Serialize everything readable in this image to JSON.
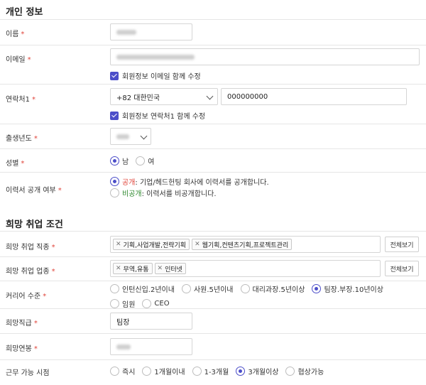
{
  "personal": {
    "title": "개인 정보",
    "name_label": "이름",
    "email_label": "이메일",
    "email_sync_label": "회원정보 이메일 함께 수정",
    "phone_label": "연락처1",
    "country_code": "+82 대한민국",
    "phone_number": "000000000",
    "phone_sync_label": "회원정보 연락처1 함께 수정",
    "birth_year_label": "출생년도",
    "gender_label": "성별",
    "gender_options": [
      "남",
      "여"
    ],
    "gender_selected": "남",
    "visibility_label": "이력서 공개 여부",
    "visibility_public_tag": "공개",
    "visibility_public_desc": " : 기업/헤드헌팅 회사에 이력서를 공개합니다.",
    "visibility_private_tag": "비공개",
    "visibility_private_desc": " : 이력서를 비공개합니다."
  },
  "job": {
    "title": "희망 취업 조건",
    "role_label": "희망 취업 직종",
    "role_tags": [
      "기획,사업개발,전략기획",
      "웹기획,컨텐츠기획,프로젝트관리"
    ],
    "industry_label": "희망 취업 업종",
    "industry_tags": [
      "무역,유통",
      "인터넷"
    ],
    "view_all": "전체보기",
    "career_label": "커리어 수준",
    "career_options": [
      "인턴신입.2년이내",
      "사원.5년이내",
      "대리과장.5년이상",
      "팀장.부장.10년이상",
      "임원",
      "CEO"
    ],
    "career_selected": "팀장.부장.10년이상",
    "position_label": "희망직급",
    "position_value": "팀장",
    "salary_label": "희망연봉",
    "start_label": "근무 가능 시점",
    "start_options": [
      "즉시",
      "1개월이내",
      "1-3개월",
      "3개월이상",
      "협상가능"
    ],
    "start_selected": "3개월이상"
  },
  "colors": {
    "accent": "#4c4ec9",
    "required": "#e0443a",
    "private": "#2f8a2f",
    "border": "#d5d5d5"
  },
  "icons": {
    "checkbox": "checked-checkbox-icon",
    "select": "chevron-down-icon",
    "tag_remove": "close-icon"
  }
}
